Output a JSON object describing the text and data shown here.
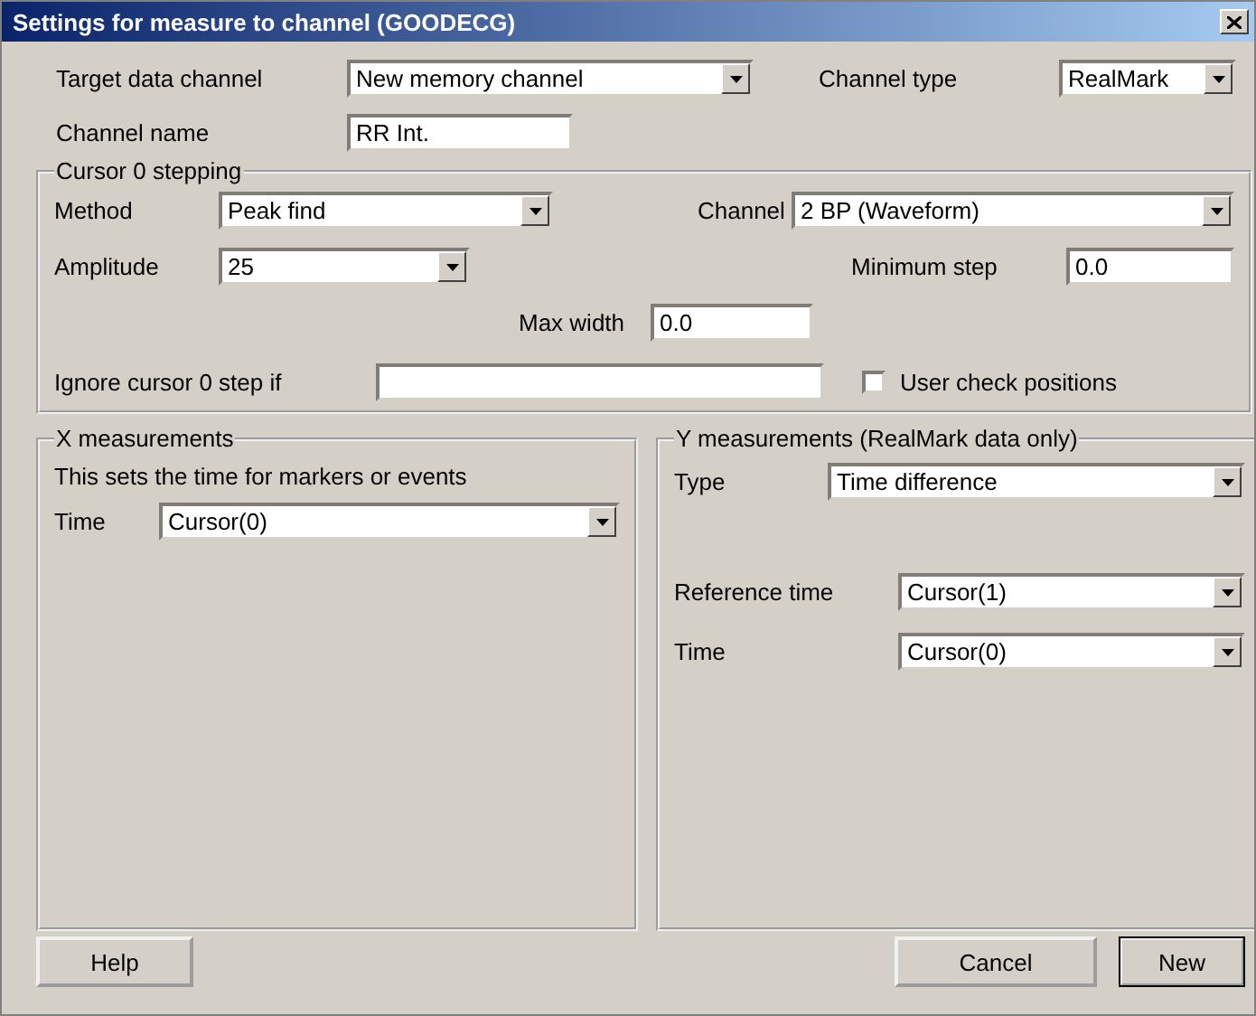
{
  "window": {
    "title": "Settings for measure to channel (GOODECG)"
  },
  "target_data_channel": {
    "label": "Target data channel",
    "value": "New memory channel"
  },
  "channel_type": {
    "label": "Channel type",
    "value": "RealMark"
  },
  "channel_name": {
    "label": "Channel name",
    "value": "RR Int."
  },
  "cursor_stepping": {
    "title": "Cursor 0 stepping",
    "method": {
      "label": "Method",
      "value": "Peak find"
    },
    "channel": {
      "label": "Channel",
      "value": "2 BP (Waveform)"
    },
    "amplitude": {
      "label": "Amplitude",
      "value": "25"
    },
    "minimum_step": {
      "label": "Minimum step",
      "value": "0.0"
    },
    "max_width": {
      "label": "Max width",
      "value": "0.0"
    },
    "ignore_step_if": {
      "label": "Ignore cursor 0 step if"
    },
    "user_check_positions": {
      "label": "User check positions",
      "checked": false
    }
  },
  "x_measurements": {
    "title": "X measurements",
    "description": "This sets the time for markers or events",
    "time": {
      "label": "Time",
      "value": "Cursor(0)"
    }
  },
  "y_measurements": {
    "title": "Y measurements (RealMark data only)",
    "type": {
      "label": "Type",
      "value": "Time difference"
    },
    "reference_time": {
      "label": "Reference time",
      "value": "Cursor(1)"
    },
    "time": {
      "label": "Time",
      "value": "Cursor(0)"
    }
  },
  "buttons": [
    {
      "label": "Help",
      "default": false
    },
    {
      "label": "Cancel",
      "default": false
    },
    {
      "label": "New",
      "default": true
    }
  ]
}
